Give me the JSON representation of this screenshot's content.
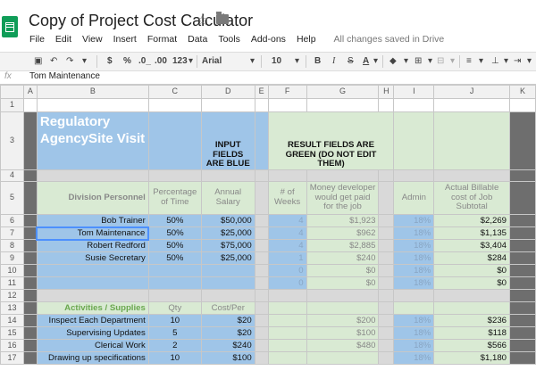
{
  "app": {
    "doc_title": "Copy of Project Cost Calculator",
    "menu": [
      "File",
      "Edit",
      "View",
      "Insert",
      "Format",
      "Data",
      "Tools",
      "Add-ons",
      "Help"
    ],
    "save_status": "All changes saved in Drive"
  },
  "toolbar": {
    "currency": "$",
    "percent": "%",
    "dec_less": ".0_",
    "dec_more": ".00",
    "more_formats": "123",
    "font": "Arial",
    "font_size": "10",
    "bold": "B",
    "italic": "I",
    "strike": "S",
    "text_color": "A"
  },
  "formula": {
    "fx_label": "fx",
    "value": "Tom Maintenance"
  },
  "columns": [
    "A",
    "B",
    "C",
    "D",
    "E",
    "F",
    "G",
    "H",
    "I",
    "J",
    "K"
  ],
  "rows": {
    "r3": {
      "title": "Regulatory AgencySite Visit",
      "input_note": "INPUT FIELDS ARE BLUE",
      "result_note": "RESULT FIELDS ARE GREEN (DO NOT EDIT THEM)"
    },
    "r5": {
      "division": "Division Personnel",
      "pct": "Percentage of Time",
      "salary": "Annual Salary",
      "weeks": "# of Weeks",
      "money": "Money developer would get paid for the job",
      "admin": "Admin",
      "billable": "Actual Billable cost of Job Subtotal"
    },
    "personnel": [
      {
        "num": "6",
        "name": "Bob Trainer",
        "pct": "50%",
        "salary": "$50,000",
        "weeks": "4",
        "money": "$1,923",
        "admin": "18%",
        "billable": "$2,269"
      },
      {
        "num": "7",
        "name": "Tom Maintenance",
        "pct": "50%",
        "salary": "$25,000",
        "weeks": "4",
        "money": "$962",
        "admin": "18%",
        "billable": "$1,135"
      },
      {
        "num": "8",
        "name": "Robert Redford",
        "pct": "50%",
        "salary": "$75,000",
        "weeks": "4",
        "money": "$2,885",
        "admin": "18%",
        "billable": "$3,404"
      },
      {
        "num": "9",
        "name": "Susie Secretary",
        "pct": "50%",
        "salary": "$25,000",
        "weeks": "1",
        "money": "$240",
        "admin": "18%",
        "billable": "$284"
      },
      {
        "num": "10",
        "name": "",
        "pct": "",
        "salary": "",
        "weeks": "0",
        "money": "$0",
        "admin": "18%",
        "billable": "$0"
      },
      {
        "num": "11",
        "name": "",
        "pct": "",
        "salary": "",
        "weeks": "0",
        "money": "$0",
        "admin": "18%",
        "billable": "$0"
      }
    ],
    "r13": {
      "activities": "Activities / Supplies",
      "qty": "Qty",
      "cost": "Cost/Per"
    },
    "activities": [
      {
        "num": "14",
        "name": "Inspect Each Department",
        "qty": "10",
        "cost": "$20",
        "money": "$200",
        "admin": "18%",
        "billable": "$236"
      },
      {
        "num": "15",
        "name": "Supervising Updates",
        "qty": "5",
        "cost": "$20",
        "money": "$100",
        "admin": "18%",
        "billable": "$118"
      },
      {
        "num": "16",
        "name": "Clerical Work",
        "qty": "2",
        "cost": "$240",
        "money": "$480",
        "admin": "18%",
        "billable": "$566"
      },
      {
        "num": "17",
        "name": "Drawing up specifications",
        "qty": "10",
        "cost": "$100",
        "money": "",
        "admin": "18%",
        "billable": "$1,180"
      }
    ]
  }
}
